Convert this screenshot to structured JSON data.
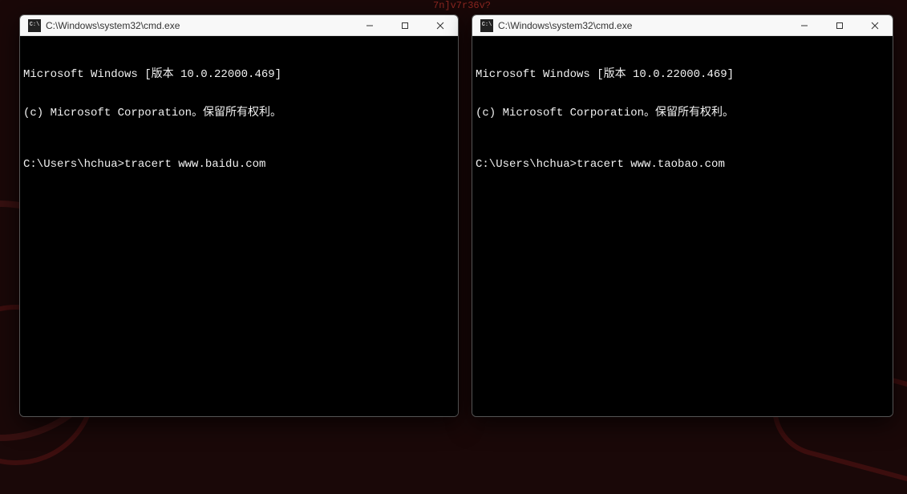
{
  "background": {
    "decor_text_1": "",
    "decor_text_2": "7n]v7r36v?"
  },
  "windows": [
    {
      "key": "left",
      "title": "C:\\Windows\\system32\\cmd.exe",
      "icon_label": "cmd-icon",
      "icon_text": "C:\\",
      "controls": {
        "minimize": "minimize-button",
        "maximize": "maximize-button",
        "close": "close-button"
      },
      "terminal": {
        "banner_line1": "Microsoft Windows [版本 10.0.22000.469]",
        "banner_line2": "(c) Microsoft Corporation。保留所有权利。",
        "prompt": "C:\\Users\\hchua>",
        "command": "tracert www.baidu.com"
      }
    },
    {
      "key": "right",
      "title": "C:\\Windows\\system32\\cmd.exe",
      "icon_label": "cmd-icon",
      "icon_text": "C:\\",
      "controls": {
        "minimize": "minimize-button",
        "maximize": "maximize-button",
        "close": "close-button"
      },
      "terminal": {
        "banner_line1": "Microsoft Windows [版本 10.0.22000.469]",
        "banner_line2": "(c) Microsoft Corporation。保留所有权利。",
        "prompt": "C:\\Users\\hchua>",
        "command": "tracert www.taobao.com"
      }
    }
  ]
}
